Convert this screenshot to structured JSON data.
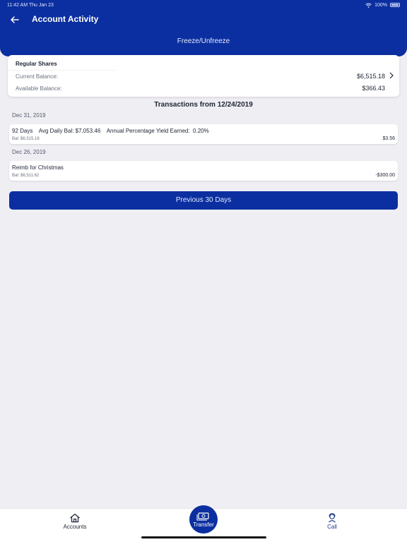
{
  "status_bar": {
    "time": "11:42 AM",
    "date": "Thu Jan 23",
    "battery": "100%"
  },
  "header": {
    "title": "Account Activity",
    "action": "Freeze/Unfreeze"
  },
  "account": {
    "name": "Regular Shares",
    "current_balance_label": "Current Balance:",
    "current_balance": "$6,515.18",
    "available_balance_label": "Available Balance:",
    "available_balance": "$366.43"
  },
  "transactions_heading": "Transactions from 12/24/2019",
  "transactions": [
    {
      "date": "Dec 31, 2019",
      "description": "92 Days    Avg Daily Bal: $7,053.46    Annual Percentage Yield Earned:  0.20%",
      "balance": "Bal: $6,515.18",
      "amount": "$3.56"
    },
    {
      "date": "Dec 26, 2019",
      "description": "Reimb for Christmas",
      "balance": "Bal: $6,511.62",
      "amount": "-$300.00"
    }
  ],
  "previous_button": "Previous 30 Days",
  "tabbar": {
    "accounts": "Accounts",
    "transfer": "Transfer",
    "call": "Call"
  },
  "colors": {
    "brand": "#0b2fa0",
    "background": "#efeef3"
  }
}
